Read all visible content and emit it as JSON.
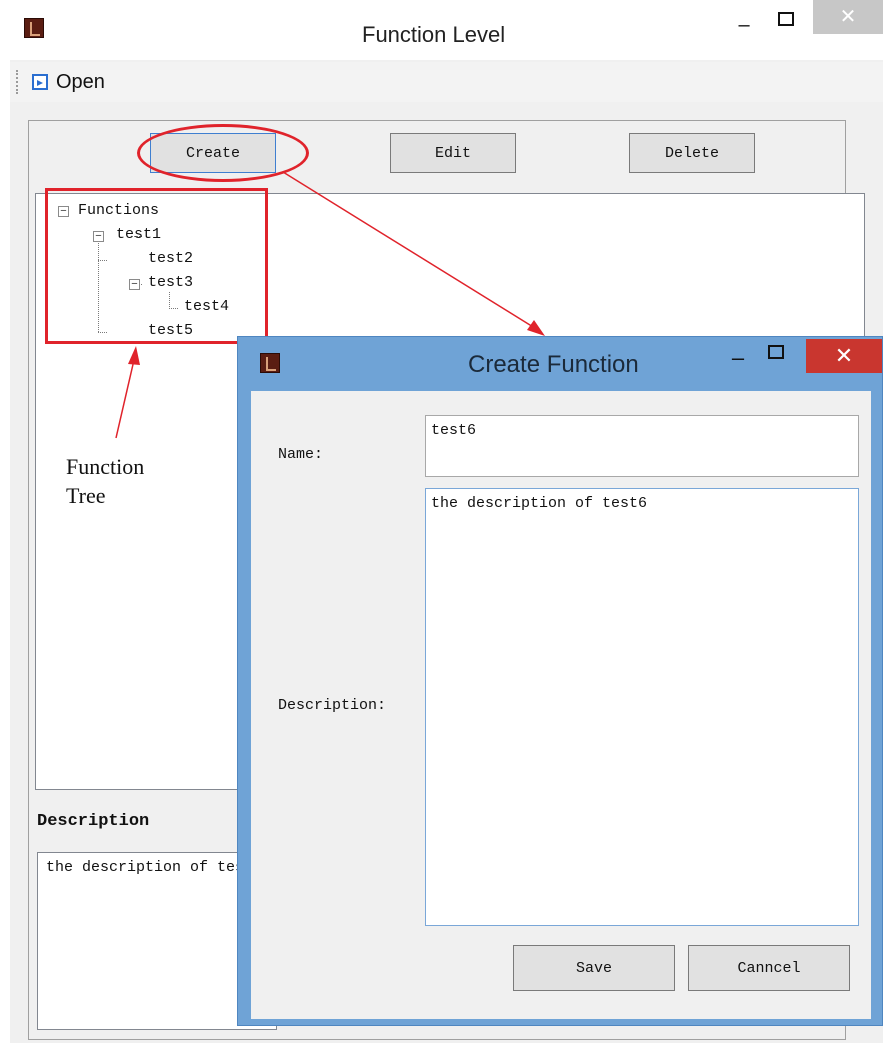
{
  "main_window": {
    "title": "Function Level",
    "minimize_glyph": "–",
    "close_glyph": "✕",
    "menu_open_label": "Open",
    "buttons": {
      "create": "Create",
      "edit": "Edit",
      "delete": "Delete"
    },
    "tree": {
      "root": "Functions",
      "nodes": [
        "test1",
        "test2",
        "test3",
        "test4",
        "test5"
      ]
    },
    "description_header": "Description",
    "description_text": "the description of test6"
  },
  "annotation": {
    "label_line1": "Function",
    "label_line2": "Tree",
    "color": "#e0232b"
  },
  "dialog": {
    "title": "Create Function",
    "minimize_glyph": "–",
    "close_glyph": "✕",
    "name_label": "Name:",
    "name_value": "test6",
    "description_label": "Description:",
    "description_value": "the description of test6",
    "save_label": "Save",
    "cancel_label": "Canncel"
  },
  "colors": {
    "dialog_frame": "#6fa3d6",
    "dialog_close": "#c9362f",
    "focus_border": "#7aa7d8"
  }
}
